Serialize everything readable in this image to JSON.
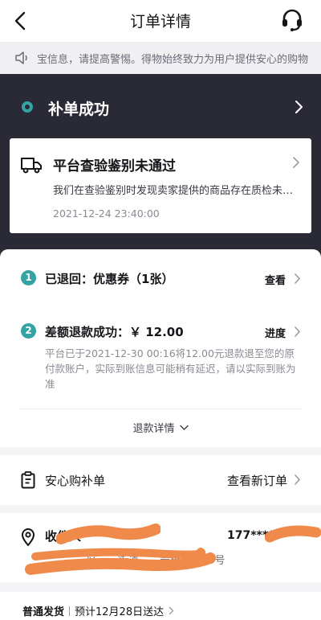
{
  "header": {
    "title": "订单详情"
  },
  "notice": {
    "text": "宝信息，请提高警惕。得物始终致力为用户提供安心的购物"
  },
  "order_status": {
    "label": "补单成功"
  },
  "inspection": {
    "title": "平台查验鉴别未通过",
    "description": "我们在查验鉴别时发现卖家提供的商品存在质检未通过问题",
    "time": "2021-12-24 23:40:00"
  },
  "refund": {
    "steps": [
      {
        "number": "1",
        "title": "已退回：优惠券（1张）",
        "action": "查看"
      },
      {
        "number": "2",
        "title": "差额退款成功：￥ 12.00",
        "action": "进度",
        "detail": "平台已于2021-12-30 00:16将12.00元退款退至您的原付款账户，实际到账信息可能稍有延迟，请以实际到账为准"
      }
    ],
    "details_label": "退款详情"
  },
  "reorder": {
    "label": "安心购补单",
    "action": "查看新订单"
  },
  "address": {
    "label": "收件人",
    "phone": "177****",
    "line": "…………区……街道……号楼……15号"
  },
  "shipping": {
    "method": "普通发货",
    "estimate": "预计12月28日送达"
  },
  "colors": {
    "accent": "#33a3a3",
    "dark_panel": "#2a2a37",
    "redaction": "#f08a4b"
  }
}
